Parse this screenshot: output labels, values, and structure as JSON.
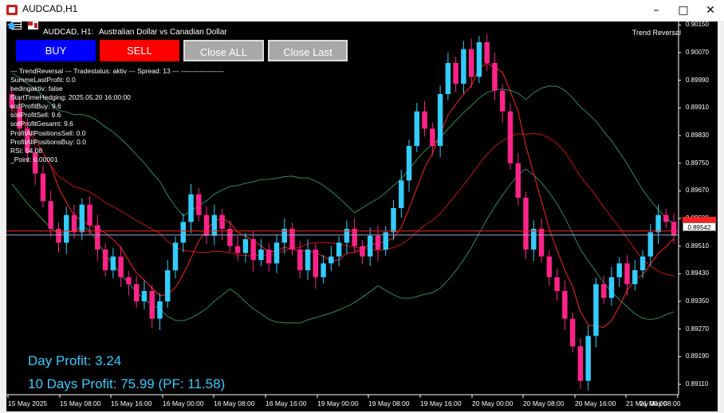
{
  "window": {
    "title": "AUDCAD,H1"
  },
  "chart": {
    "header_symbol": "AUDCAD, H1:",
    "header_description": "Australian Dollar vs Canadian Dollar",
    "ea_name": "Trend Reversal",
    "current_price": "0.89542",
    "bid_price_label": "0.89565"
  },
  "buttons": {
    "buy": "BUY",
    "sell": "SELL",
    "close_all": "Close ALL",
    "close_last": "Close Last"
  },
  "info_lines": [
    "--- TrendReversal --- Tradestatus: aktiv --- Spread: 13 --- -------------------",
    "SummeLastProfit: 0.0",
    "hedingaktiv: false",
    "StartTimeHedging: 2025.05.20 16:00:00",
    "sollProfitBuy: 9.6",
    "sollProfitSell: 9.6",
    "sollProfitGesamt: 9.6",
    "ProfitAllPositionsSell: 0.0",
    "ProfitAllPositionsBuy: 0.0",
    "RSI: 54.08",
    "_Point: 0.00001"
  ],
  "profits": {
    "day": "Day Profit: 3.24",
    "ten_days": "10 Days Profit: 75.99 (PF: 11.58)"
  },
  "colors": {
    "bull": "#33ccff",
    "bear": "#ff2288",
    "background": "#000000",
    "ma_fast": "#ff2020",
    "ma_slow": "#cc1010",
    "bands": "#2e8b57"
  },
  "chart_data": {
    "type": "candlestick",
    "symbol": "AUDCAD",
    "timeframe": "H1",
    "y_ticks": [
      "0.90150",
      "0.90070",
      "0.89990",
      "0.89910",
      "0.89830",
      "0.89750",
      "0.89670",
      "0.89590",
      "0.89510",
      "0.89430",
      "0.89350",
      "0.89270",
      "0.89190",
      "0.89110"
    ],
    "x_ticks": [
      "15 May 2025",
      "15 May 08:00",
      "15 May 16:00",
      "16 May 00:00",
      "16 May 08:00",
      "16 May 16:00",
      "19 May 00:00",
      "19 May 08:00",
      "19 May 16:00",
      "20 May 00:00",
      "20 May 08:00",
      "20 May 16:00",
      "21 May 00:00",
      "21 May 08:00"
    ],
    "ylim": [
      0.8908,
      0.9016
    ],
    "closes": [
      0.8991,
      0.8985,
      0.8978,
      0.8972,
      0.8964,
      0.8956,
      0.8952,
      0.896,
      0.8955,
      0.8963,
      0.8957,
      0.895,
      0.8944,
      0.8948,
      0.8942,
      0.894,
      0.8935,
      0.8938,
      0.893,
      0.8935,
      0.8944,
      0.8952,
      0.8958,
      0.8966,
      0.896,
      0.8954,
      0.896,
      0.8956,
      0.8951,
      0.8949,
      0.8953,
      0.8947,
      0.895,
      0.8946,
      0.8952,
      0.8956,
      0.895,
      0.8944,
      0.895,
      0.8942,
      0.8946,
      0.8948,
      0.8952,
      0.8956,
      0.8951,
      0.8948,
      0.8954,
      0.895,
      0.8955,
      0.8962,
      0.897,
      0.898,
      0.899,
      0.8985,
      0.898,
      0.8995,
      0.9004,
      0.8998,
      0.9008,
      0.9,
      0.901,
      0.9004,
      0.8996,
      0.899,
      0.8975,
      0.8965,
      0.895,
      0.8956,
      0.8948,
      0.8942,
      0.8938,
      0.893,
      0.8922,
      0.8912,
      0.8925,
      0.894,
      0.8936,
      0.8942,
      0.8946,
      0.894,
      0.8944,
      0.8948,
      0.8955,
      0.896,
      0.8958,
      0.8954
    ]
  }
}
